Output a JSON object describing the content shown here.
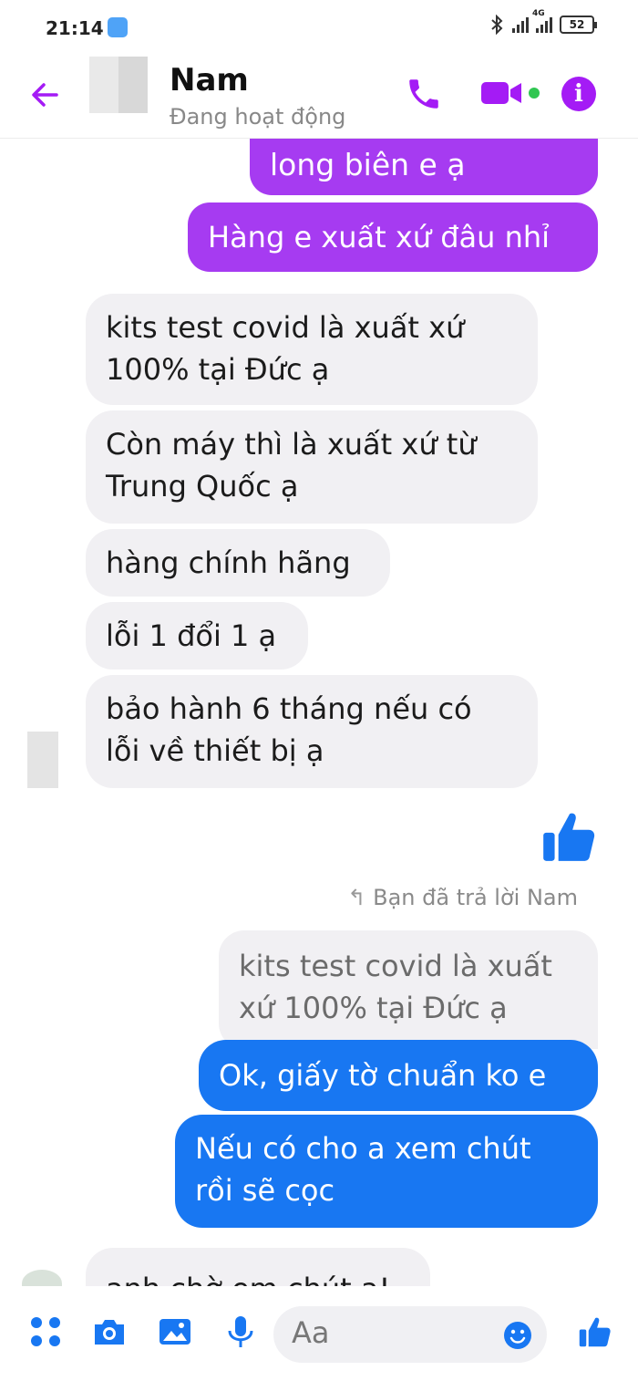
{
  "status": {
    "time": "21:14",
    "battery": "52",
    "net_label": "4G"
  },
  "header": {
    "name": "Nam",
    "status": "Đang hoạt động"
  },
  "messages": {
    "m1": "long biên e ạ",
    "m2": "Hàng e xuất xứ đâu nhỉ",
    "m3_l1": "kits test covid là xuất xứ",
    "m3_l2": "100% tại Đức ạ",
    "m4_l1": "Còn máy thì là xuất xứ từ",
    "m4_l2": "Trung Quốc ạ",
    "m5": "hàng chính hãng",
    "m6": "lỗi 1 đổi 1 ạ",
    "m7_l1": "bảo hành 6 tháng nếu có",
    "m7_l2": "lỗi về thiết bị ạ",
    "reply_note": "Bạn đã trả lời Nam",
    "quote_l1": "kits test covid là xuất",
    "quote_l2": "xứ 100% tại Đức ạ",
    "m8": "Ok,  giấy tờ chuẩn ko e",
    "m9_l1": "Nếu có cho a xem chút",
    "m9_l2": "rồi sẽ cọc",
    "m10": "anh chờ em chút ạ!"
  },
  "composer": {
    "placeholder": "Aa"
  },
  "colors": {
    "accent": "#a63bf1",
    "blue": "#1877f2",
    "bubble_gray": "#f1f0f3"
  },
  "icons": [
    "back-arrow-icon",
    "phone-icon",
    "video-icon",
    "info-icon",
    "apps-icon",
    "camera-icon",
    "image-icon",
    "mic-icon",
    "emoji-icon",
    "like-icon"
  ]
}
